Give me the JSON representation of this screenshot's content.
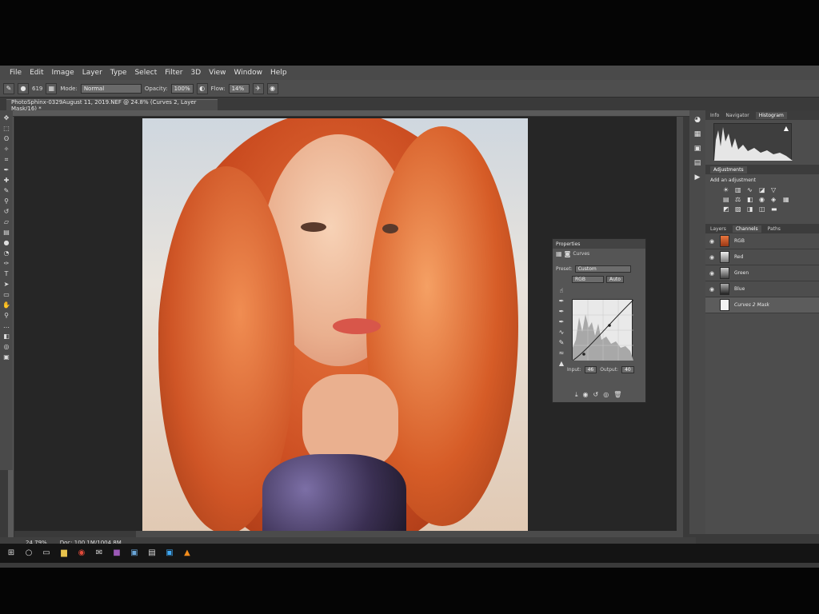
{
  "menu": [
    "File",
    "Edit",
    "Image",
    "Layer",
    "Type",
    "Select",
    "Filter",
    "3D",
    "View",
    "Window",
    "Help"
  ],
  "options": {
    "brush_size": "619",
    "mode_label": "Mode:",
    "mode_value": "Normal",
    "opacity_label": "Opacity:",
    "opacity_value": "100%",
    "flow_label": "Flow:",
    "flow_value": "14%"
  },
  "document_tab": "PhotoSphinx-0329August 11, 2019.NEF @ 24.8% (Curves 2, Layer Mask/16) *",
  "status": {
    "zoom": "24.79%",
    "doc": "Doc: 100.1M/1004.8M"
  },
  "properties_panel": {
    "title": "Properties",
    "type_label": "Curves",
    "preset_label": "Preset:",
    "preset_value": "Custom",
    "channel_value": "RGB",
    "auto_label": "Auto",
    "input_label": "Input:",
    "input_value": "46",
    "output_label": "Output:",
    "output_value": "40"
  },
  "top_panel_tabs": [
    "Info",
    "Navigator",
    "Histogram"
  ],
  "adjustments": {
    "tab": "Adjustments",
    "title": "Add an adjustment"
  },
  "layers_tabs": [
    "Layers",
    "Channels",
    "Paths"
  ],
  "channels": [
    {
      "name": "RGB"
    },
    {
      "name": "Red"
    },
    {
      "name": "Green"
    },
    {
      "name": "Blue"
    },
    {
      "name": "Curves 2 Mask"
    }
  ],
  "colors": {
    "accent_hair": "#d9572a",
    "panel_bg": "#4d4d4d",
    "canvas_bg": "#262626"
  }
}
